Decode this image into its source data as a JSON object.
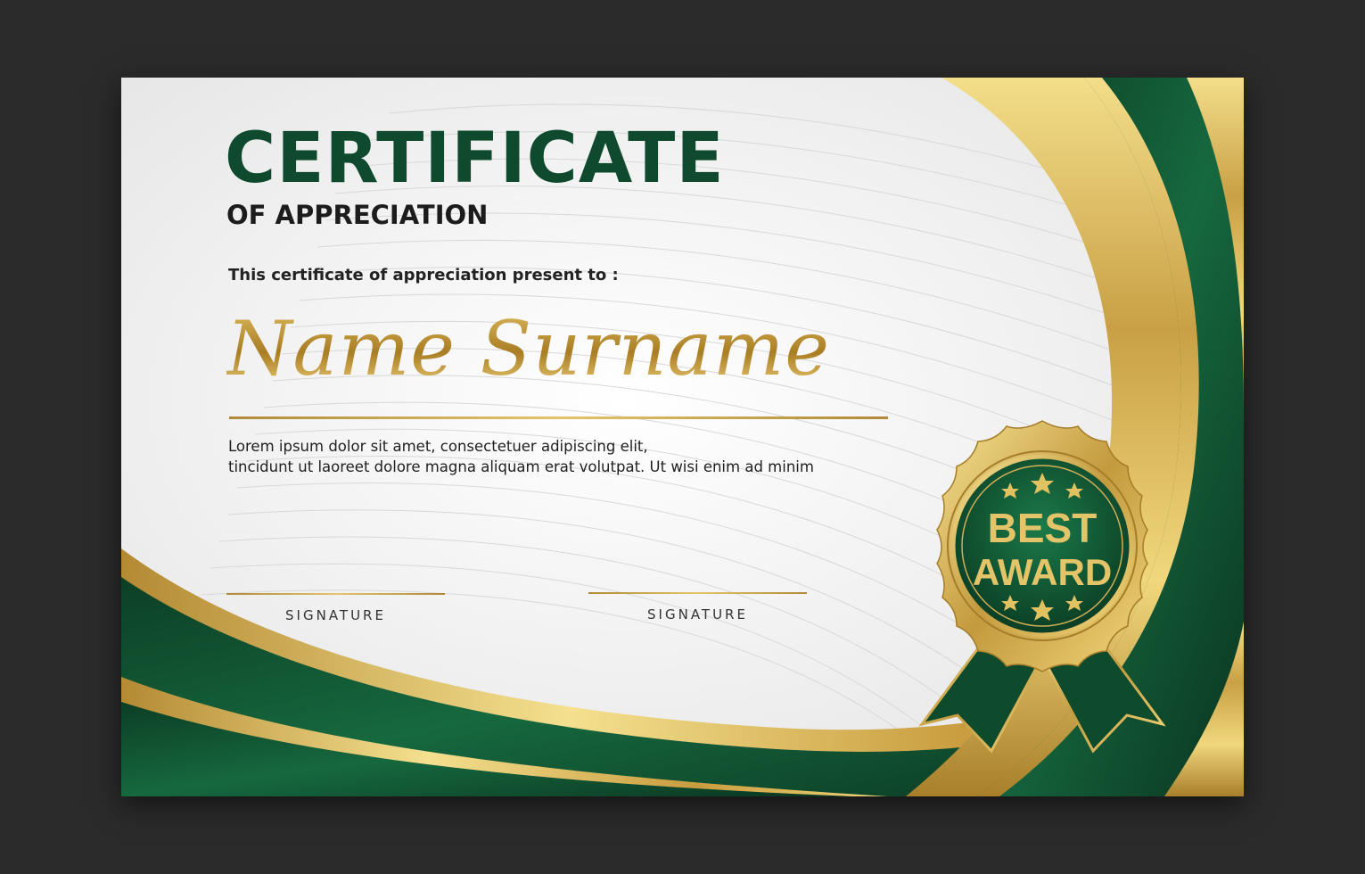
{
  "certificate": {
    "title": "CERTIFICATE",
    "subtitle": "OF APPRECIATION",
    "present_text": "This certificate of appreciation present to :",
    "recipient_name": "Name Surname",
    "body_lines": [
      "Lorem ipsum dolor sit amet, consectetuer adipiscing elit,",
      "tincidunt ut laoreet dolore magna aliquam erat volutpat. Ut wisi enim ad minim"
    ],
    "signatures": [
      {
        "label": "SIGNATURE"
      },
      {
        "label": "SIGNATURE"
      }
    ],
    "badge": {
      "line1": "BEST",
      "line2": "AWARD",
      "star_icon": "star-icon"
    }
  },
  "colors": {
    "page_background": "#2b2b2b",
    "certificate_background": "#f4f4f4",
    "primary_green": "#0f4a2e",
    "gold": "#c9a24a",
    "text_dark": "#1c1c1c"
  }
}
